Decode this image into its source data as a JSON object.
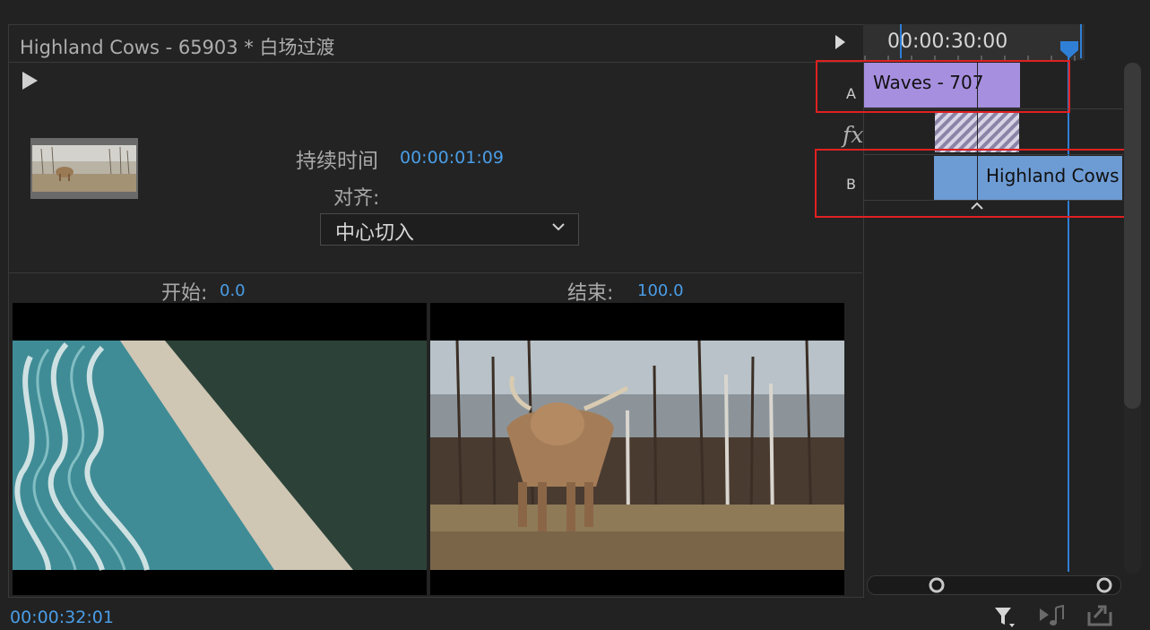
{
  "panel": {
    "title": "Highland Cows - 65903 * 白场过渡"
  },
  "transition": {
    "duration_label": "持续时间",
    "duration_value": "00:00:01:09",
    "alignment_label": "对齐:",
    "alignment_value": "中心切入",
    "start_label": "开始:",
    "start_value": "0.0",
    "end_label": "结束:",
    "end_value": "100.0"
  },
  "timeline": {
    "timecode": "00:00:30:00",
    "track_a_label": "A",
    "track_b_label": "B",
    "fx_label": "fx",
    "clip_a_label": "Waves - 707",
    "clip_b_label": "Highland Cows"
  },
  "footer": {
    "timecode": "00:00:32:01"
  },
  "icons": {
    "play": "play-icon",
    "filter": "filter-icon",
    "play_audio": "play-audio-icon",
    "export": "export-icon"
  },
  "colors": {
    "accent": "#4a9de6",
    "clip_a": "#a78fdf",
    "clip_b": "#6d9bd4",
    "highlight": "#e02020"
  }
}
